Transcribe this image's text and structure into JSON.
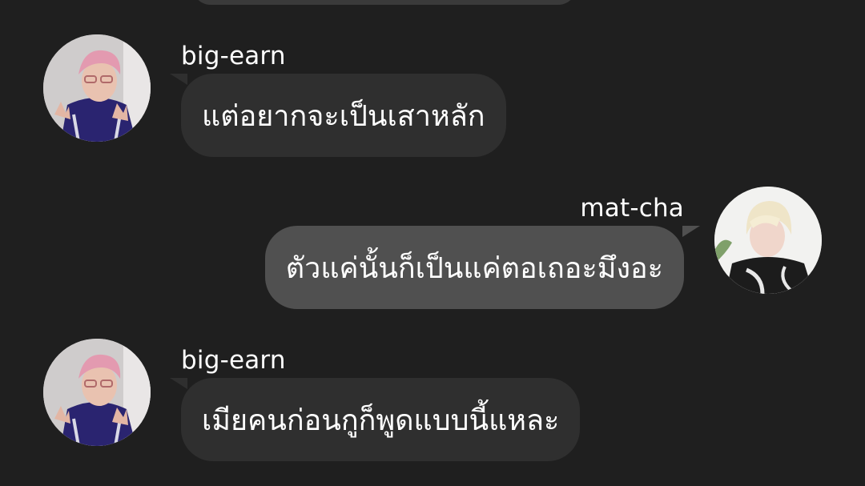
{
  "messages": [
    {
      "direction": "incoming",
      "sender": "big-earn",
      "text": "แต่อยากจะเป็นเสาหลัก",
      "avatar_icon": "pink-hair-avatar"
    },
    {
      "direction": "outgoing",
      "sender": "mat-cha",
      "text": "ตัวแค่นั้นก็เป็นแค่ตอเถอะมึงอะ",
      "avatar_icon": "blonde-hair-avatar"
    },
    {
      "direction": "incoming",
      "sender": "big-earn",
      "text": "เมียคนก่อนกูก็พูดแบบนี้แหละ",
      "avatar_icon": "pink-hair-avatar"
    }
  ],
  "colors": {
    "background": "#1f1f1f",
    "incoming_bubble": "#2f2f2f",
    "outgoing_bubble": "#505050",
    "text": "#ffffff"
  }
}
